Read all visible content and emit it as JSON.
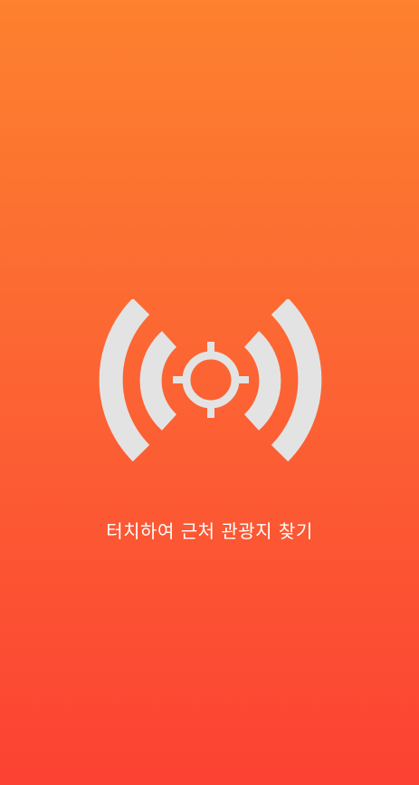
{
  "screen": {
    "cta_label": "터치하여 근처 관광지 찾기",
    "icon": "location-broadcast-icon"
  },
  "colors": {
    "gradient_top": "#FD812E",
    "gradient_bottom": "#FC4233",
    "icon": "#E3E3E3",
    "text": "#FFFFFF"
  }
}
